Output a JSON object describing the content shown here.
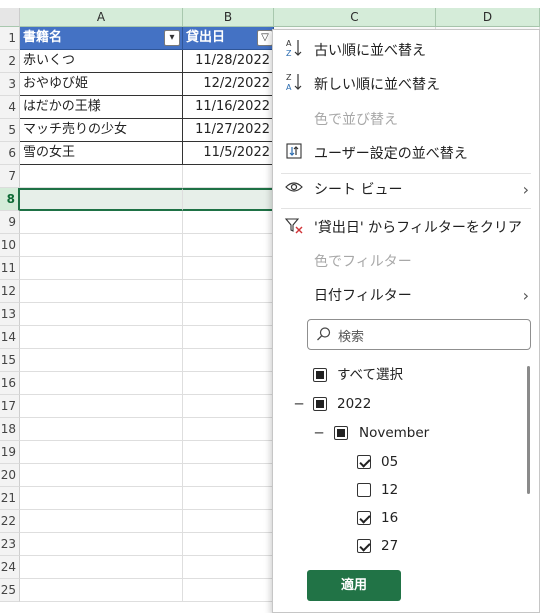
{
  "columns": [
    "A",
    "B",
    "C",
    "D"
  ],
  "row_numbers": [
    "1",
    "2",
    "3",
    "4",
    "5",
    "6",
    "7",
    "8",
    "9",
    "10",
    "11",
    "12",
    "13",
    "14",
    "15",
    "16",
    "17",
    "18",
    "19",
    "20",
    "21",
    "22",
    "23",
    "24",
    "25"
  ],
  "table": {
    "headers": [
      "書籍名",
      "貸出日"
    ],
    "rows": [
      [
        "赤いくつ",
        "11/28/2022"
      ],
      [
        "おやゆび姫",
        "12/2/2022"
      ],
      [
        "はだかの王様",
        "11/16/2022"
      ],
      [
        "マッチ売りの少女",
        "11/27/2022"
      ],
      [
        "雪の女王",
        "11/5/2022"
      ]
    ]
  },
  "menu": {
    "sort_oldest": "古い順に並べ替え",
    "sort_newest": "新しい順に並べ替え",
    "sort_by_color": "色で並び替え",
    "custom_sort": "ユーザー設定の並べ替え",
    "sheet_view": "シート ビュー",
    "clear_filter": "'貸出日' からフィルターをクリア",
    "filter_by_color": "色でフィルター",
    "date_filters": "日付フィルター",
    "search_placeholder": "検索",
    "select_all": "すべて選択",
    "year": "2022",
    "month": "November",
    "days": [
      {
        "label": "05",
        "checked": true
      },
      {
        "label": "12",
        "checked": false
      },
      {
        "label": "16",
        "checked": true
      },
      {
        "label": "27",
        "checked": true
      }
    ],
    "apply": "適用"
  },
  "colors": {
    "header_fill": "#4472c4",
    "accent_green": "#217346",
    "selection_green": "#1e7145"
  }
}
